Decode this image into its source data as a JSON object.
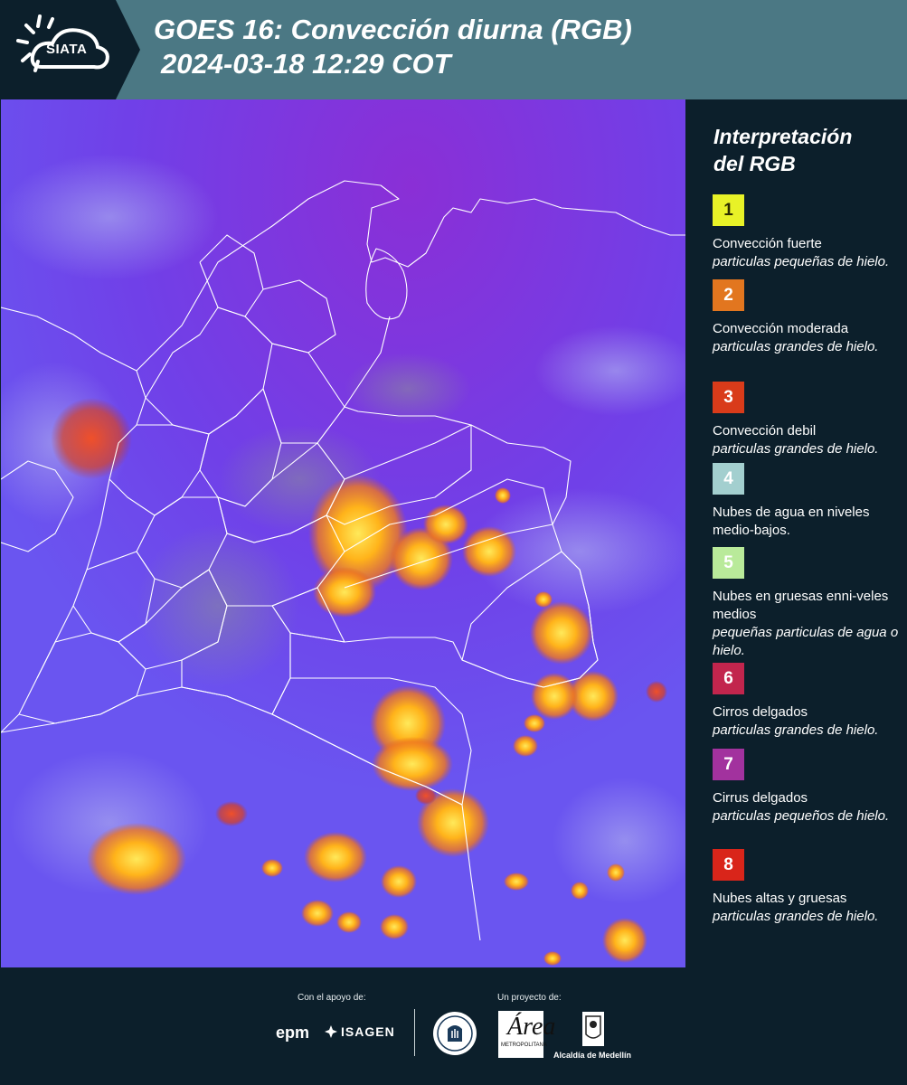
{
  "header": {
    "logo_text": "SIATA",
    "title": "GOES 16: Convección diurna (RGB)",
    "subtitle": "2024-03-18 12:29 COT"
  },
  "map": {
    "background_color": "#6a55f0",
    "border_color": "#ffffff",
    "convection_color": "#ffb31a"
  },
  "legend": {
    "title_line1": "Interpretación",
    "title_line2": "del RGB",
    "items": [
      {
        "number": "1",
        "color": "#e8f227",
        "text_color": "#2a2a00",
        "main": "Convección fuerte",
        "sub": "particulas pequeñas de hielo."
      },
      {
        "number": "2",
        "color": "#e2761f",
        "text_color": "#ffffff",
        "main": "Convección moderada",
        "sub": "particulas grandes de hielo."
      },
      {
        "number": "3",
        "color": "#d93b1a",
        "text_color": "#ffffff",
        "main": "Convección debil",
        "sub": "particulas grandes de hielo."
      },
      {
        "number": "4",
        "color": "#a3cfcf",
        "text_color": "#ffffff",
        "main": "Nubes de agua en niveles medio-bajos.",
        "sub": ""
      },
      {
        "number": "5",
        "color": "#b9ea9a",
        "text_color": "#ffffff",
        "main": "Nubes en gruesas enni-veles medios",
        "sub": "pequeñas particulas de agua o hielo."
      },
      {
        "number": "6",
        "color": "#c2254d",
        "text_color": "#ffffff",
        "main": "Cirros delgados",
        "sub": "particulas grandes de hielo."
      },
      {
        "number": "7",
        "color": "#a2329e",
        "text_color": "#ffffff",
        "main": "Cirrus delgados",
        "sub": "particulas pequeños de hielo."
      },
      {
        "number": "8",
        "color": "#d9251a",
        "text_color": "#ffffff",
        "main": "Nubes altas y gruesas",
        "sub": "particulas grandes de hielo."
      }
    ]
  },
  "footer": {
    "support_label": "Con el apoyo de:",
    "project_label": "Un proyecto de:",
    "epm": "epm",
    "isagen": "ISAGEN",
    "area_big": "Área",
    "area_small": "METROPOLITANA",
    "alcaldia": "Alcaldía de Medellín"
  }
}
